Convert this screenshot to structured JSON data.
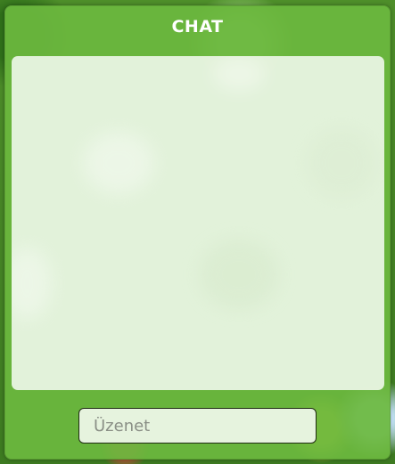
{
  "chat": {
    "title": "CHAT",
    "messages": [],
    "input": {
      "value": "",
      "placeholder": "Üzenet"
    }
  },
  "colors": {
    "panel": "#6cb83e",
    "message_area": "#ecf6e6",
    "title_text": "#ffffff",
    "input_border": "#1e2a12"
  }
}
